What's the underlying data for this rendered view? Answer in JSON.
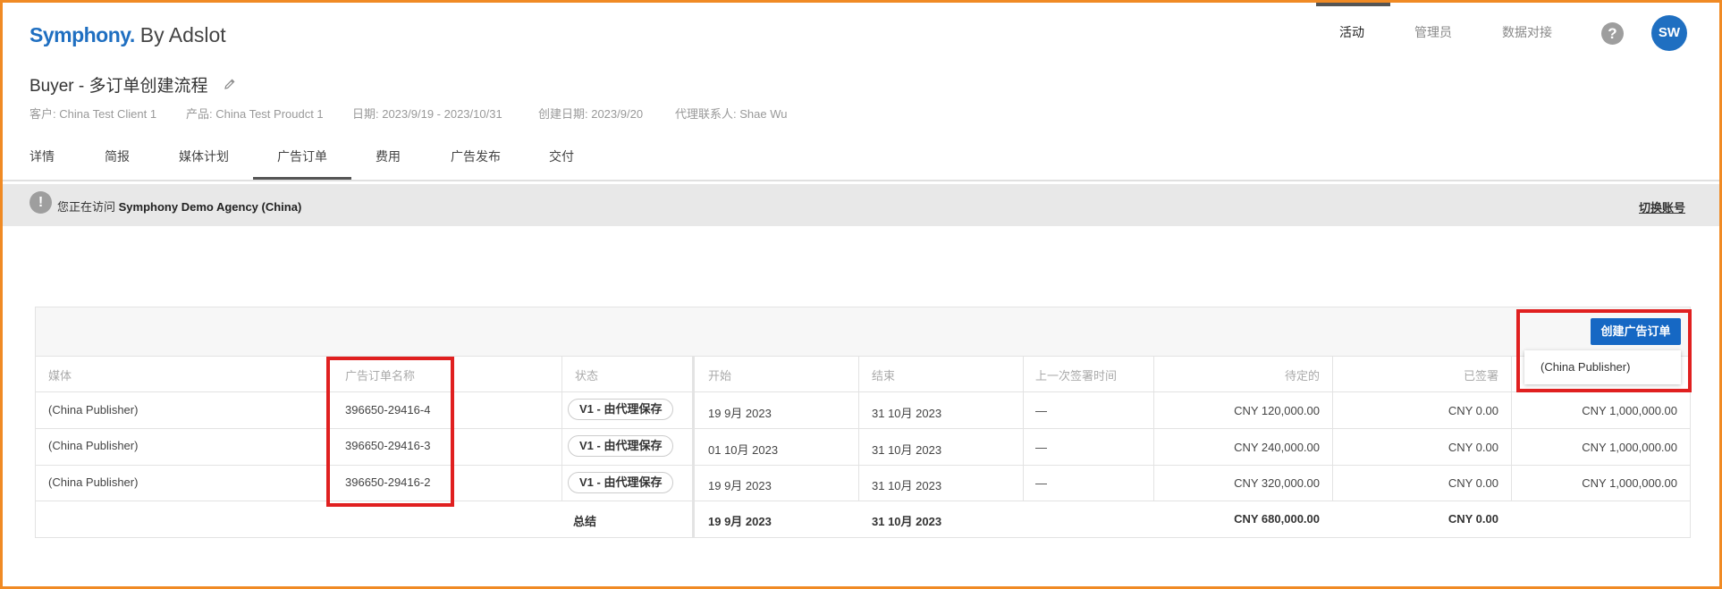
{
  "header": {
    "brand": "Symphony.",
    "brand_suffix": "By Adslot",
    "nav": [
      "活动",
      "管理员",
      "数据对接"
    ],
    "help": "?",
    "avatar": "SW"
  },
  "campaign": {
    "title": "Buyer - 多订单创建流程",
    "client": "客户: China Test Client 1",
    "product": "产品: China Test Proudct 1",
    "dates": "日期: 2023/9/19 - 2023/10/31",
    "created": "创建日期: 2023/9/20",
    "contact": "代理联系人: Shae Wu"
  },
  "tabs": [
    "详情",
    "简报",
    "媒体计划",
    "广告订单",
    "费用",
    "广告发布",
    "交付"
  ],
  "notice": {
    "icon": "!",
    "prefix": "您正在访问",
    "agency": "Symphony Demo Agency (China)",
    "switch_label": "切换账号"
  },
  "table": {
    "create_button": "创建广告订单",
    "dropdown_item": "(China Publisher)",
    "headers": [
      "媒体",
      "广告订单名称",
      "状态",
      "开始",
      "结束",
      "上一次签署时间",
      "待定的",
      "已签署"
    ],
    "rows": [
      {
        "media": "(China Publisher)",
        "name": "396650-29416-4",
        "status": "V1 - 由代理保存",
        "start": "19 9月 2023",
        "end": "31 10月 2023",
        "last_signed": "—",
        "pending": "CNY 120,000.00",
        "signed": "CNY 0.00",
        "total": "CNY 1,000,000.00"
      },
      {
        "media": "(China Publisher)",
        "name": "396650-29416-3",
        "status": "V1 - 由代理保存",
        "start": "01 10月 2023",
        "end": "31 10月 2023",
        "last_signed": "—",
        "pending": "CNY 240,000.00",
        "signed": "CNY 0.00",
        "total": "CNY 1,000,000.00"
      },
      {
        "media": "(China Publisher)",
        "name": "396650-29416-2",
        "status": "V1 - 由代理保存",
        "start": "19 9月 2023",
        "end": "31 10月 2023",
        "last_signed": "—",
        "pending": "CNY 320,000.00",
        "signed": "CNY 0.00",
        "total": "CNY 1,000,000.00"
      }
    ],
    "summary": {
      "label": "总结",
      "start": "19 9月 2023",
      "end": "31 10月 2023",
      "pending": "CNY 680,000.00",
      "signed": "CNY 0.00"
    }
  },
  "colors": {
    "accent": "#1668c4",
    "highlight": "#e02020",
    "frame": "#f08a24"
  },
  "icons": {
    "edit": "pencil-icon",
    "help": "help-icon",
    "notice": "exclamation-icon"
  }
}
